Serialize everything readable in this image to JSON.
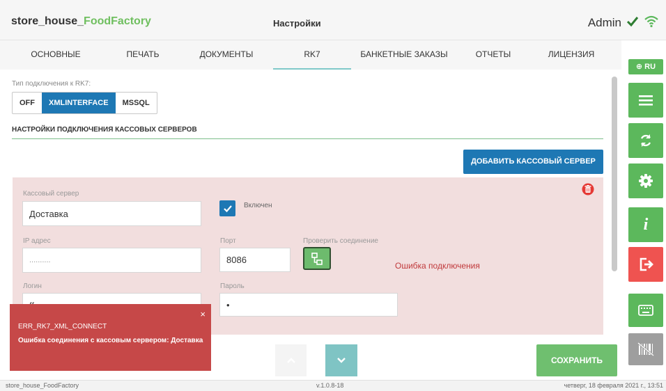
{
  "header": {
    "app_title_prefix": "store_house_",
    "app_title_accent": "FoodFactory",
    "page_title": "Настройки",
    "user": "Admin"
  },
  "tabs": [
    {
      "label": "ОСНОВНЫЕ"
    },
    {
      "label": "ПЕЧАТЬ"
    },
    {
      "label": "ДОКУМЕНТЫ"
    },
    {
      "label": "RK7"
    },
    {
      "label": "БАНКЕТНЫЕ ЗАКАЗЫ"
    },
    {
      "label": "ОТЧЕТЫ"
    },
    {
      "label": "ЛИЦЕНЗИЯ"
    }
  ],
  "sidebar": {
    "lang": "⊕ RU"
  },
  "connection": {
    "type_label": "Тип подключения к RK7:",
    "options": [
      "OFF",
      "XMLINTERFACE",
      "MSSQL"
    ],
    "selected": "XMLINTERFACE"
  },
  "section": {
    "title": "НАСТРОЙКИ ПОДКЛЮЧЕНИЯ КАССОВЫХ СЕРВЕРОВ",
    "add_button": "ДОБАВИТЬ КАССОВЫЙ СЕРВЕР"
  },
  "server": {
    "name_label": "Кассовый сервер",
    "name_value": "Доставка",
    "enabled_label": "Включен",
    "ip_label": "IP адрес",
    "ip_value": "..........",
    "port_label": "Порт",
    "port_value": "8086",
    "check_label": "Проверить соединение",
    "login_label": "Логин",
    "login_value": "ff",
    "password_label": "Пароль",
    "password_value": "•",
    "error_text": "Ошибка подключения"
  },
  "toast": {
    "close": "×",
    "code": "ERR_RK7_XML_CONNECT",
    "message": "Ошибка соединения с кассовым сервером: Доставка"
  },
  "footer": {
    "left": "store_house_FoodFactory",
    "center": "v.1.0.8-18",
    "right": "четверг, 18 февраля 2021 г., 13:51"
  },
  "actions": {
    "save": "СОХРАНИТЬ"
  },
  "colors": {
    "accent_green": "#6fbf5f",
    "primary_blue": "#1e78b4",
    "error_red": "#c0393b",
    "card_bg": "#f2dede"
  }
}
